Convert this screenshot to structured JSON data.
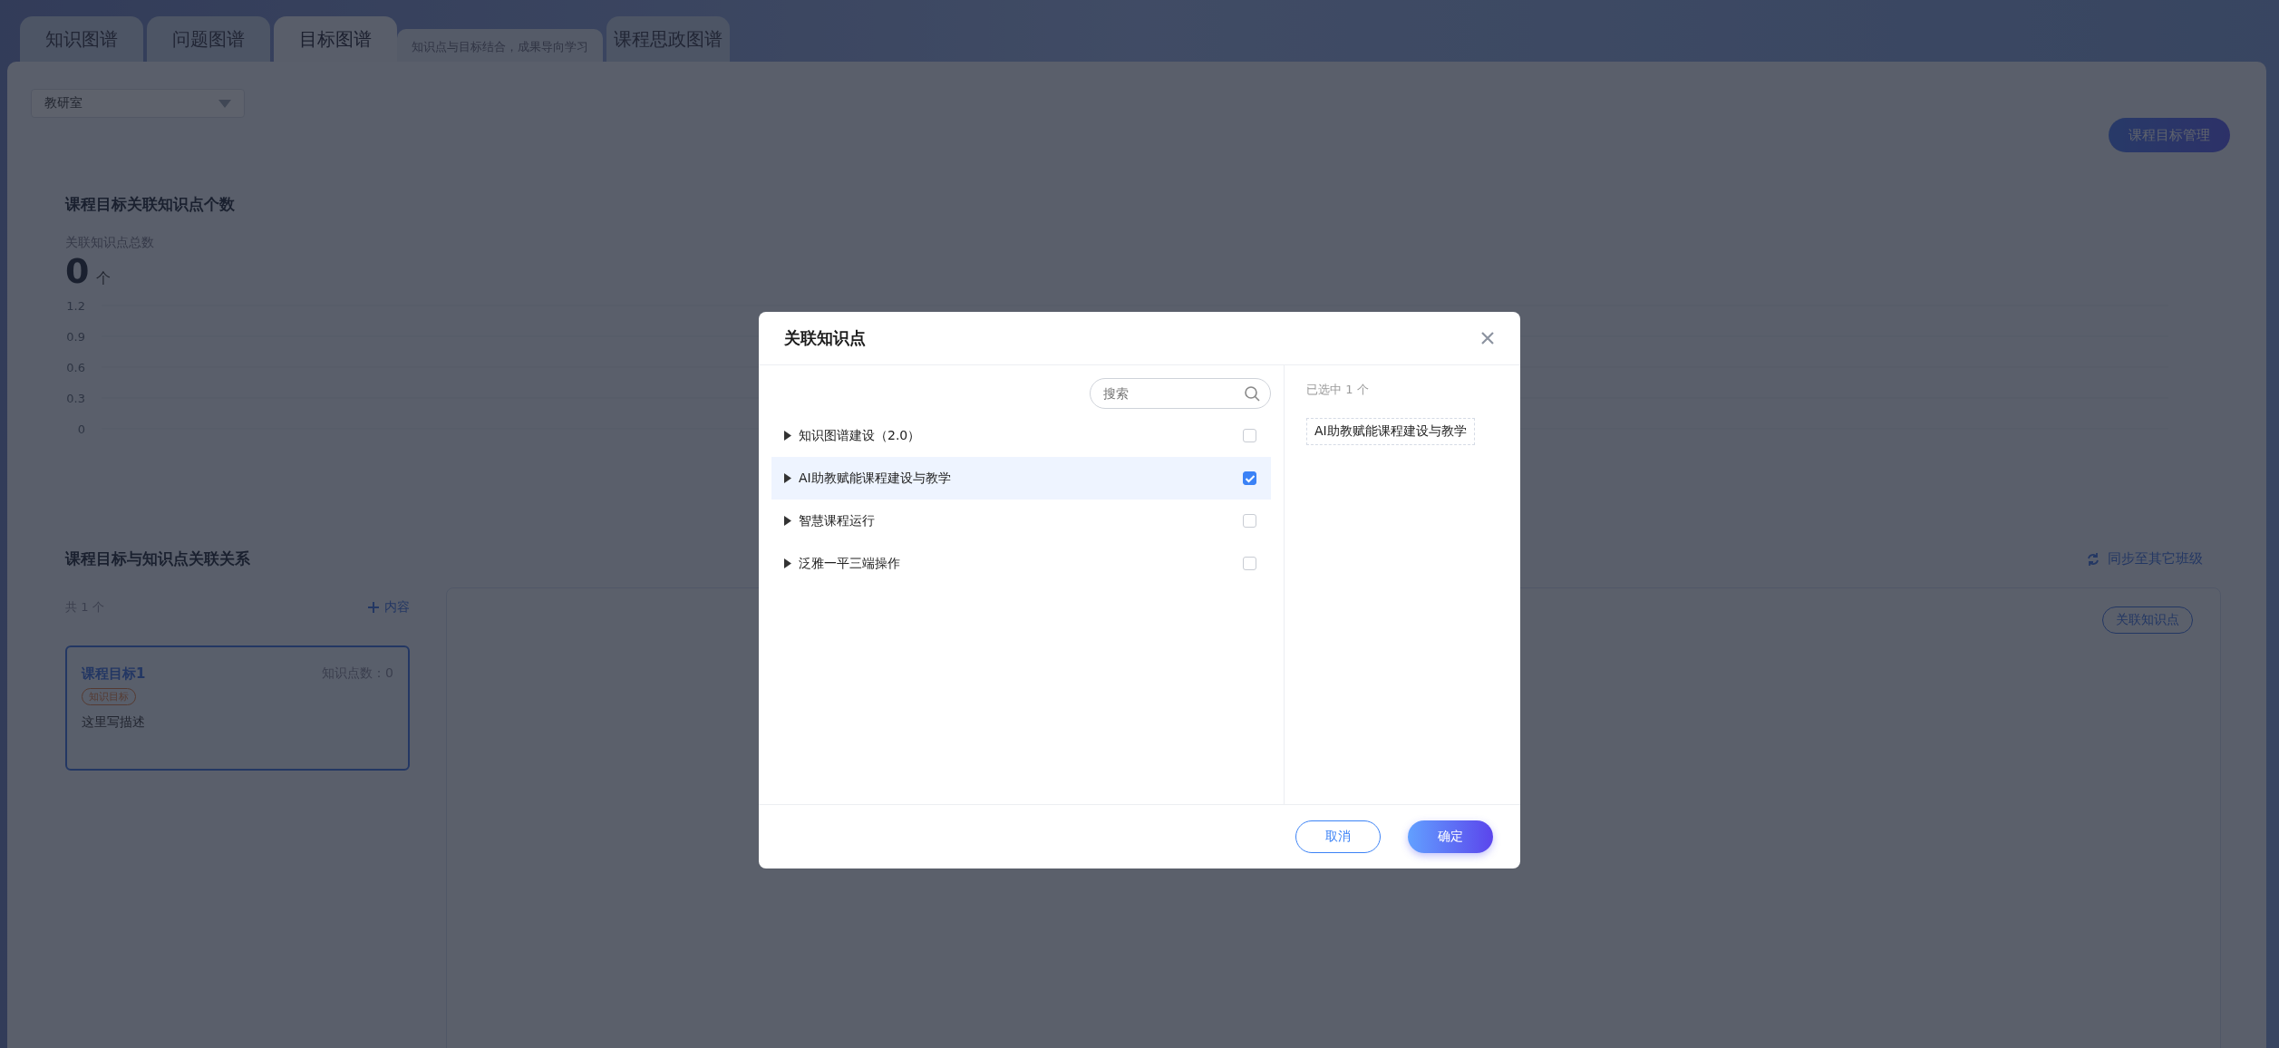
{
  "tabs": [
    {
      "label": "知识图谱",
      "selected": false
    },
    {
      "label": "问题图谱",
      "selected": false
    },
    {
      "label": "目标图谱",
      "selected": true,
      "hint": "知识点与目标结合，成果导向学习"
    },
    {
      "label": "课程思政图谱",
      "selected": false
    }
  ],
  "department_select": {
    "value": "教研室"
  },
  "manage_button": "课程目标管理",
  "stats": {
    "title": "课程目标关联知识点个数",
    "label": "关联知识点总数",
    "value": "0",
    "unit": "个",
    "axis_labels": [
      "1.2",
      "0.9",
      "0.6",
      "0.3",
      "0"
    ]
  },
  "relations": {
    "title": "课程目标与知识点关联关系",
    "sync_link": "同步至其它班级",
    "count": "共 1 个",
    "add_button": "内容",
    "goals": [
      {
        "title": "课程目标1",
        "points": "知识点数：0",
        "tag": "知识目标",
        "description": "这里写描述",
        "selected": true
      }
    ],
    "link_button": "关联知识点"
  },
  "dialog": {
    "title": "关联知识点",
    "search": {
      "placeholder": "搜索"
    },
    "tree": [
      {
        "label": "知识图谱建设（2.0）",
        "checked": false,
        "selected": false
      },
      {
        "label": "AI助教赋能课程建设与教学",
        "checked": true,
        "selected": true
      },
      {
        "label": "智慧课程运行",
        "checked": false,
        "selected": false
      },
      {
        "label": "泛雅一平三端操作",
        "checked": false,
        "selected": false
      }
    ],
    "selected_count": "已选中 1 个",
    "selected_items": [
      "AI助教赋能课程建设与教学"
    ],
    "buttons": [
      {
        "label": "取消",
        "kind": "secondary"
      },
      {
        "label": "确定",
        "kind": "primary"
      }
    ]
  }
}
